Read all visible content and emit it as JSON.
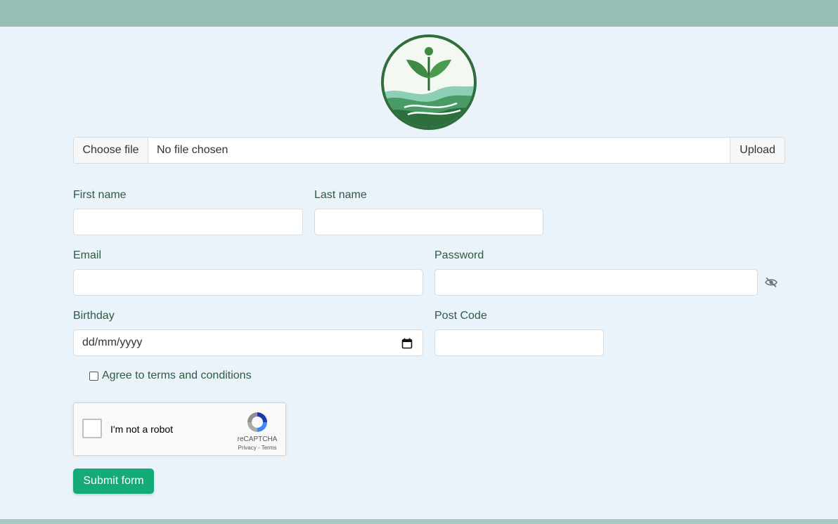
{
  "upload": {
    "choose_label": "Choose file",
    "file_status": "No file chosen",
    "upload_label": "Upload"
  },
  "form": {
    "first_name_label": "First name",
    "last_name_label": "Last name",
    "email_label": "Email",
    "password_label": "Password",
    "birthday_label": "Birthday",
    "birthday_placeholder": "dd/mm/yyyy",
    "postcode_label": "Post Code",
    "agree_label": "Agree to terms and conditions",
    "submit_label": "Submit form"
  },
  "recaptcha": {
    "label": "I'm not a robot",
    "brand": "reCAPTCHA",
    "links": "Privacy - Terms"
  },
  "colors": {
    "header": "#97bdb4",
    "background": "#eaf3f9",
    "accent": "#14ab78"
  }
}
